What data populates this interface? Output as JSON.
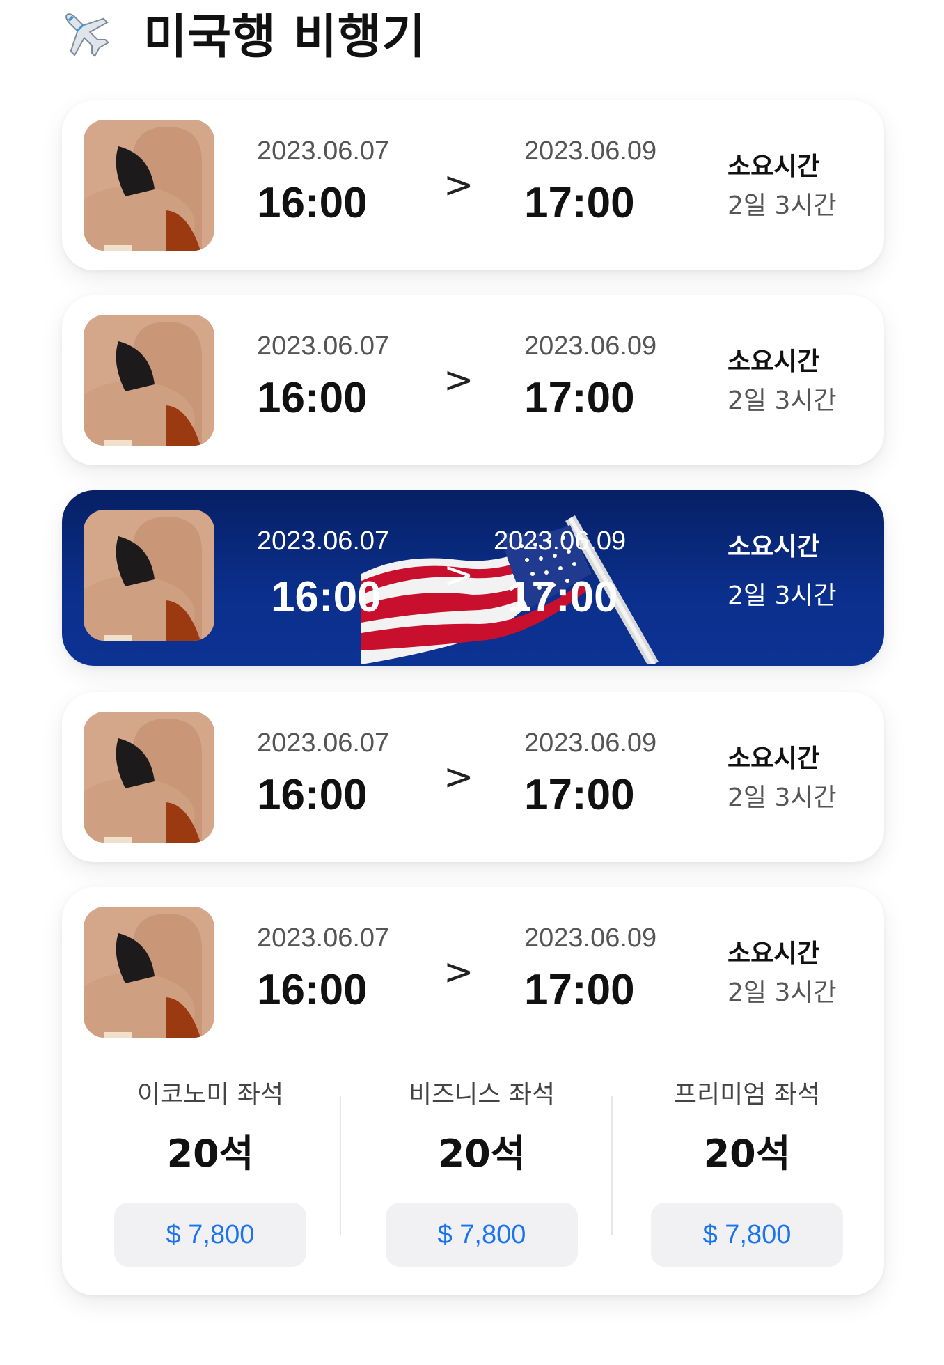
{
  "header": {
    "title": "미국행 비행기",
    "icon": "airplane-icon"
  },
  "flights": [
    {
      "departure_date": "2023.06.07",
      "departure_time": "16:00",
      "arrow": ">",
      "arrival_date": "2023.06.09",
      "arrival_time": "17:00",
      "duration_label": "소요시간",
      "duration_value": "2일 3시간"
    },
    {
      "departure_date": "2023.06.07",
      "departure_time": "16:00",
      "arrow": ">",
      "arrival_date": "2023.06.09",
      "arrival_time": "17:00",
      "duration_label": "소요시간",
      "duration_value": "2일 3시간"
    },
    {
      "departure_date": "2023.06.07",
      "departure_time": "16:00",
      "arrow": ">",
      "arrival_date": "2023.06.09",
      "arrival_time": "17:00",
      "duration_label": "소요시간",
      "duration_value": "2일 3시간",
      "selected": true
    },
    {
      "departure_date": "2023.06.07",
      "departure_time": "16:00",
      "arrow": ">",
      "arrival_date": "2023.06.09",
      "arrival_time": "17:00",
      "duration_label": "소요시간",
      "duration_value": "2일 3시간"
    },
    {
      "departure_date": "2023.06.07",
      "departure_time": "16:00",
      "arrow": ">",
      "arrival_date": "2023.06.09",
      "arrival_time": "17:00",
      "duration_label": "소요시간",
      "duration_value": "2일 3시간",
      "expanded": true
    }
  ],
  "seats": [
    {
      "name": "이코노미 좌석",
      "count": "20석",
      "price": "$ 7,800"
    },
    {
      "name": "비즈니스 좌석",
      "count": "20석",
      "price": "$ 7,800"
    },
    {
      "name": "프리미엄 좌석",
      "count": "20석",
      "price": "$ 7,800"
    }
  ],
  "colors": {
    "selected_card": "#0b2f8c",
    "price_text": "#1b73f0",
    "price_bg": "#f1f1f3",
    "thumb_bg": "#d4a78a"
  }
}
